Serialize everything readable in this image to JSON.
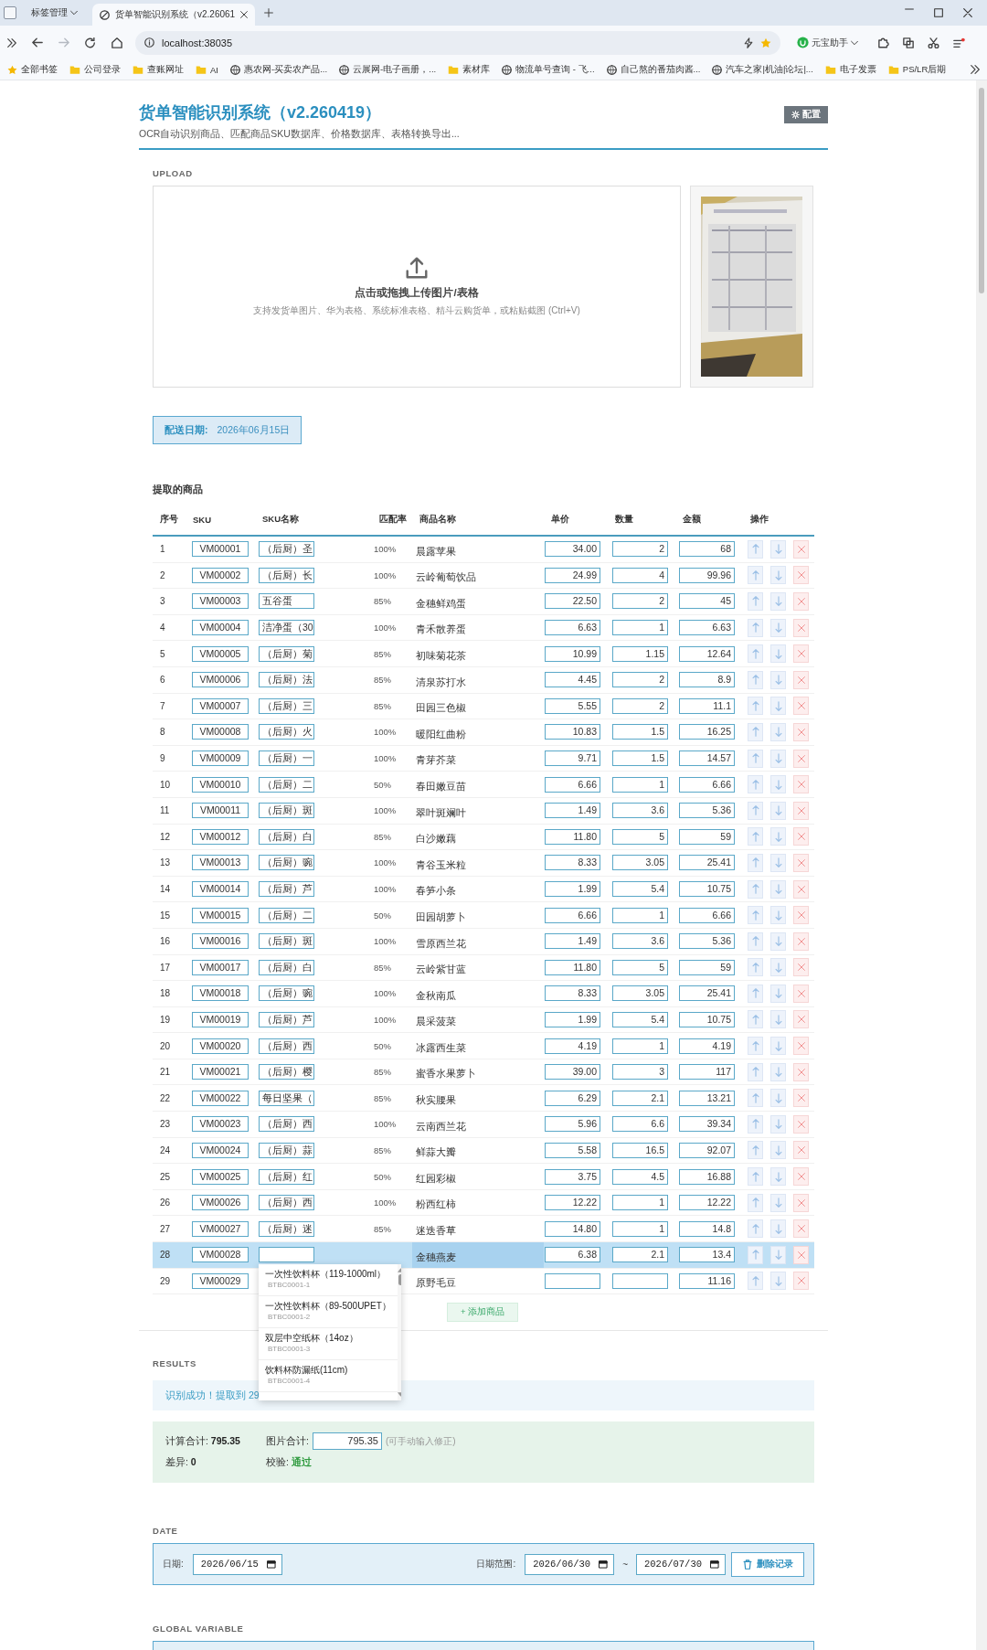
{
  "browser": {
    "tab_group": "标签管理",
    "tabs": [
      {
        "title": "货单智能识别系统（v2.26061",
        "selected": true
      }
    ],
    "address": "localhost:38035",
    "assistant": "元宝助手",
    "bookmarks": [
      {
        "label": "全部书签",
        "kind": "star"
      },
      {
        "label": "公司登录",
        "kind": "folder"
      },
      {
        "label": "查账网址",
        "kind": "folder"
      },
      {
        "label": "AI",
        "kind": "folder"
      },
      {
        "label": "惠农网-买卖农产品...",
        "kind": "site"
      },
      {
        "label": "云展网-电子画册，...",
        "kind": "site"
      },
      {
        "label": "素材库",
        "kind": "folder"
      },
      {
        "label": "物流单号查询 - 飞...",
        "kind": "site"
      },
      {
        "label": "自己熬的番茄肉酱...",
        "kind": "site"
      },
      {
        "label": "汽车之家|机油|论坛|...",
        "kind": "site"
      },
      {
        "label": "电子发票",
        "kind": "folder"
      },
      {
        "label": "PS/LR后期",
        "kind": "folder"
      }
    ]
  },
  "header": {
    "title": "货单智能识别系统（v2.260419）",
    "subtitle": "OCR自动识别商品、匹配商品SKU数据库、价格数据库、表格转换导出...",
    "config_button": "配置"
  },
  "upload": {
    "section_label": "UPLOAD",
    "prompt": "点击或拖拽上传图片/表格",
    "hint": "支持发货单图片、华为表格、系统标准表格、精斗云购货单，或粘贴截图 (Ctrl+V)"
  },
  "delivery": {
    "label": "配送日期:",
    "value": "2026年06月15日"
  },
  "table": {
    "title": "提取的商品",
    "columns": [
      "序号",
      "SKU",
      "SKU名称",
      "匹配率",
      "商品名称",
      "单价",
      "数量",
      "金额",
      "操作"
    ],
    "rows": [
      {
        "seq": "1",
        "sku": "VM00001",
        "sku_name": "（后厨）圣",
        "match": "100%",
        "product": "晨露苹果",
        "price": "34.00",
        "qty": "2",
        "amount": "68",
        "selected": false
      },
      {
        "seq": "2",
        "sku": "VM00002",
        "sku_name": "（后厨）长",
        "match": "100%",
        "product": "云岭葡萄饮品",
        "price": "24.99",
        "qty": "4",
        "amount": "99.96",
        "selected": false
      },
      {
        "seq": "3",
        "sku": "VM00003",
        "sku_name": "五谷蛋",
        "match": "85%",
        "product": "金穗鲜鸡蛋",
        "price": "22.50",
        "qty": "2",
        "amount": "45",
        "selected": false
      },
      {
        "seq": "4",
        "sku": "VM00004",
        "sku_name": "洁净蛋（30",
        "match": "100%",
        "product": "青禾散养蛋",
        "price": "6.63",
        "qty": "1",
        "amount": "6.63",
        "selected": false
      },
      {
        "seq": "5",
        "sku": "VM00005",
        "sku_name": "（后厨）菊",
        "match": "85%",
        "product": "初味菊花茶",
        "price": "10.99",
        "qty": "1.15",
        "amount": "12.64",
        "selected": false
      },
      {
        "seq": "6",
        "sku": "VM00006",
        "sku_name": "（后厨）法",
        "match": "85%",
        "product": "清泉苏打水",
        "price": "4.45",
        "qty": "2",
        "amount": "8.9",
        "selected": false
      },
      {
        "seq": "7",
        "sku": "VM00007",
        "sku_name": "（后厨）三",
        "match": "85%",
        "product": "田园三色椒",
        "price": "5.55",
        "qty": "2",
        "amount": "11.1",
        "selected": false
      },
      {
        "seq": "8",
        "sku": "VM00008",
        "sku_name": "（后厨）火",
        "match": "100%",
        "product": "暖阳红曲粉",
        "price": "10.83",
        "qty": "1.5",
        "amount": "16.25",
        "selected": false
      },
      {
        "seq": "9",
        "sku": "VM00009",
        "sku_name": "（后厨）一",
        "match": "100%",
        "product": "青芽芥菜",
        "price": "9.71",
        "qty": "1.5",
        "amount": "14.57",
        "selected": false
      },
      {
        "seq": "10",
        "sku": "VM00010",
        "sku_name": "（后厨）二",
        "match": "50%",
        "product": "春田嫩豆苗",
        "price": "6.66",
        "qty": "1",
        "amount": "6.66",
        "selected": false
      },
      {
        "seq": "11",
        "sku": "VM00011",
        "sku_name": "（后厨）斑",
        "match": "100%",
        "product": "翠叶斑斓叶",
        "price": "1.49",
        "qty": "3.6",
        "amount": "5.36",
        "selected": false
      },
      {
        "seq": "12",
        "sku": "VM00012",
        "sku_name": "（后厨）白",
        "match": "85%",
        "product": "白沙嫩藕",
        "price": "11.80",
        "qty": "5",
        "amount": "59",
        "selected": false
      },
      {
        "seq": "13",
        "sku": "VM00013",
        "sku_name": "（后厨）豌",
        "match": "100%",
        "product": "青谷玉米粒",
        "price": "8.33",
        "qty": "3.05",
        "amount": "25.41",
        "selected": false
      },
      {
        "seq": "14",
        "sku": "VM00014",
        "sku_name": "（后厨）芦",
        "match": "100%",
        "product": "春笋小条",
        "price": "1.99",
        "qty": "5.4",
        "amount": "10.75",
        "selected": false
      },
      {
        "seq": "15",
        "sku": "VM00015",
        "sku_name": "（后厨）二",
        "match": "50%",
        "product": "田园胡萝卜",
        "price": "6.66",
        "qty": "1",
        "amount": "6.66",
        "selected": false
      },
      {
        "seq": "16",
        "sku": "VM00016",
        "sku_name": "（后厨）斑",
        "match": "100%",
        "product": "雪原西兰花",
        "price": "1.49",
        "qty": "3.6",
        "amount": "5.36",
        "selected": false
      },
      {
        "seq": "17",
        "sku": "VM00017",
        "sku_name": "（后厨）白",
        "match": "85%",
        "product": "云岭紫甘蓝",
        "price": "11.80",
        "qty": "5",
        "amount": "59",
        "selected": false
      },
      {
        "seq": "18",
        "sku": "VM00018",
        "sku_name": "（后厨）豌",
        "match": "100%",
        "product": "金秋南瓜",
        "price": "8.33",
        "qty": "3.05",
        "amount": "25.41",
        "selected": false
      },
      {
        "seq": "19",
        "sku": "VM00019",
        "sku_name": "（后厨）芦",
        "match": "100%",
        "product": "晨采菠菜",
        "price": "1.99",
        "qty": "5.4",
        "amount": "10.75",
        "selected": false
      },
      {
        "seq": "20",
        "sku": "VM00020",
        "sku_name": "（后厨）西",
        "match": "50%",
        "product": "冰露西生菜",
        "price": "4.19",
        "qty": "1",
        "amount": "4.19",
        "selected": false
      },
      {
        "seq": "21",
        "sku": "VM00021",
        "sku_name": "（后厨）樱",
        "match": "85%",
        "product": "蜜香水果萝卜",
        "price": "39.00",
        "qty": "3",
        "amount": "117",
        "selected": false
      },
      {
        "seq": "22",
        "sku": "VM00022",
        "sku_name": "每日坚果（",
        "match": "85%",
        "product": "秋实腰果",
        "price": "6.29",
        "qty": "2.1",
        "amount": "13.21",
        "selected": false
      },
      {
        "seq": "23",
        "sku": "VM00023",
        "sku_name": "（后厨）西",
        "match": "100%",
        "product": "云南西兰花",
        "price": "5.96",
        "qty": "6.6",
        "amount": "39.34",
        "selected": false
      },
      {
        "seq": "24",
        "sku": "VM00024",
        "sku_name": "（后厨）蒜",
        "match": "85%",
        "product": "鲜蒜大瓣",
        "price": "5.58",
        "qty": "16.5",
        "amount": "92.07",
        "selected": false
      },
      {
        "seq": "25",
        "sku": "VM00025",
        "sku_name": "（后厨）红",
        "match": "50%",
        "product": "红园彩椒",
        "price": "3.75",
        "qty": "4.5",
        "amount": "16.88",
        "selected": false
      },
      {
        "seq": "26",
        "sku": "VM00026",
        "sku_name": "（后厨）西",
        "match": "100%",
        "product": "粉西红柿",
        "price": "12.22",
        "qty": "1",
        "amount": "12.22",
        "selected": false
      },
      {
        "seq": "27",
        "sku": "VM00027",
        "sku_name": "（后厨）迷",
        "match": "85%",
        "product": "迷迭香草",
        "price": "14.80",
        "qty": "1",
        "amount": "14.8",
        "selected": false
      },
      {
        "seq": "28",
        "sku": "VM00028",
        "product": "金穗燕麦",
        "price": "6.38",
        "qty": "2.1",
        "amount": "13.4",
        "selected": true
      },
      {
        "seq": "29",
        "sku": "VM00029",
        "product": "原野毛豆",
        "amount": "11.16",
        "selected": false
      }
    ],
    "sku_suggestions": [
      {
        "name": "一次性饮料杯（119-1000ml）",
        "code": "BTBC0001-1"
      },
      {
        "name": "一次性饮料杯（89-500UPET）",
        "code": "BTBC0001-2"
      },
      {
        "name": "双层中空纸杯（14oz）",
        "code": "BTBC0001-3"
      },
      {
        "name": "饮料杯防漏纸(11cm)",
        "code": "BTBC0001-4"
      }
    ],
    "add_button": "+ 添加商品"
  },
  "results": {
    "section_label": "RESULTS",
    "message": "识别成功！提取到 29",
    "computed_total_label": "计算合计:",
    "computed_total": "795.35",
    "image_total_label": "图片合计:",
    "image_total": "795.35",
    "image_total_note": "(可手动输入修正)",
    "difference_label": "差异:",
    "difference": "0",
    "check_label": "校验:",
    "check_value": "通过",
    "check_passed": true
  },
  "date": {
    "section_label": "DATE",
    "date_label": "日期:",
    "date": "2026/06/15",
    "range_label": "日期范围:",
    "range_start": "2026/06/30",
    "range_separator": "~",
    "range_end": "2026/07/30",
    "delete_button": "删除记录"
  },
  "global_variable": {
    "section_label": "GLOBAL VARIABLE"
  }
}
